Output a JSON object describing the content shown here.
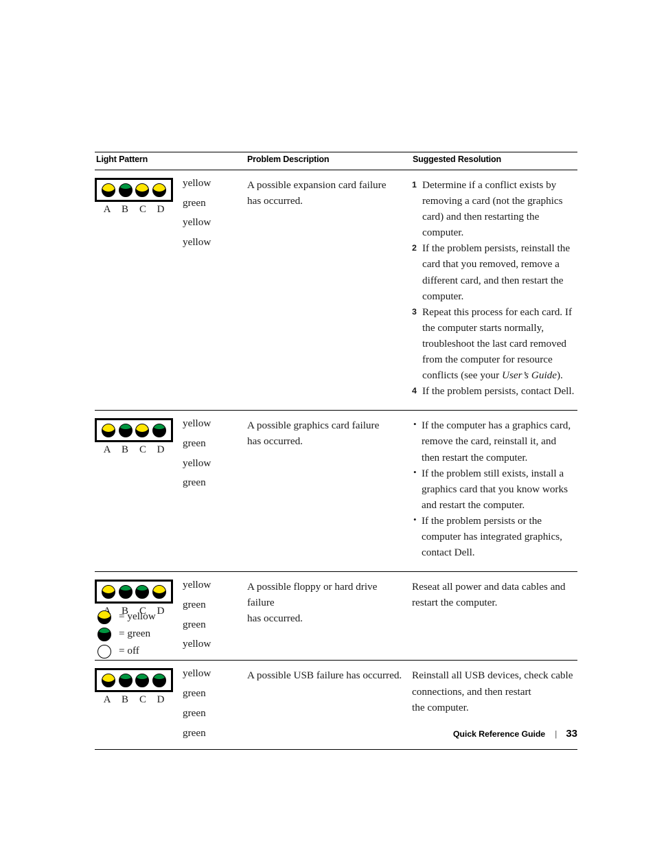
{
  "table": {
    "headers": {
      "light_pattern": "Light Pattern",
      "problem_description": "Problem Description",
      "suggested_resolution": "Suggested Resolution"
    },
    "rows": [
      {
        "leds": [
          "yellow",
          "green",
          "yellow",
          "yellow"
        ],
        "led_labels": [
          "A",
          "B",
          "C",
          "D"
        ],
        "colors": [
          "yellow",
          "green",
          "yellow",
          "yellow"
        ],
        "problem_line1": "A possible expansion card failure",
        "problem_line2": "has occurred.",
        "resolution_type": "numbered",
        "steps": [
          {
            "num": "1",
            "text_pre": "Determine if a conflict exists by removing a card (not the graphics card) and then restarting the computer.",
            "italic": "",
            "text_post": ""
          },
          {
            "num": "2",
            "text_pre": "If the problem persists, reinstall the card that you removed, remove a different card, and then restart the computer.",
            "italic": "",
            "text_post": ""
          },
          {
            "num": "3",
            "text_pre": "Repeat this process for each card. If the computer starts normally, troubleshoot the last card removed from the computer for resource conflicts (see your ",
            "italic": "User’s Guide",
            "text_post": ")."
          },
          {
            "num": "4",
            "text_pre": "If the problem persists, contact Dell.",
            "italic": "",
            "text_post": ""
          }
        ]
      },
      {
        "leds": [
          "yellow",
          "green",
          "yellow",
          "green"
        ],
        "led_labels": [
          "A",
          "B",
          "C",
          "D"
        ],
        "colors": [
          "yellow",
          "green",
          "yellow",
          "green"
        ],
        "problem_line1": "A possible graphics card failure",
        "problem_line2": "has occurred.",
        "resolution_type": "bulleted",
        "bullets": [
          "If the computer has a graphics card, remove the card, reinstall it, and then restart the computer.",
          "If the problem still exists, install a graphics card that you know works and restart the computer.",
          "If the problem persists or the computer has integrated graphics, contact Dell."
        ]
      },
      {
        "leds": [
          "yellow",
          "green",
          "green",
          "yellow"
        ],
        "led_labels": [
          "A",
          "B",
          "C",
          "D"
        ],
        "colors": [
          "yellow",
          "green",
          "green",
          "yellow"
        ],
        "problem_line1": "A possible floppy or hard drive failure",
        "problem_line2": "has occurred.",
        "resolution_type": "plain",
        "plain_line1": "Reseat all power and data cables and",
        "plain_line2": "restart the computer."
      },
      {
        "leds": [
          "yellow",
          "green",
          "green",
          "green"
        ],
        "led_labels": [
          "A",
          "B",
          "C",
          "D"
        ],
        "colors": [
          "yellow",
          "green",
          "green",
          "green"
        ],
        "problem_line1": "A possible USB failure has occurred.",
        "problem_line2": "",
        "resolution_type": "plain",
        "plain_line1": "Reinstall all USB devices, check cable",
        "plain_line2": "connections, and then restart",
        "plain_line3": "the computer."
      }
    ]
  },
  "legend": [
    {
      "state": "yellow",
      "label": "= yellow"
    },
    {
      "state": "green",
      "label": "= green"
    },
    {
      "state": "off",
      "label": "= off"
    }
  ],
  "footer": {
    "guide_name": "Quick Reference Guide",
    "separator": "|",
    "page_number": "33"
  },
  "colors": {
    "led_yellow": "#FFE600",
    "led_green": "#009640",
    "led_body": "#000000",
    "led_off": "#FFFFFF",
    "rule": "#000000",
    "text": "#1A1A1A"
  }
}
